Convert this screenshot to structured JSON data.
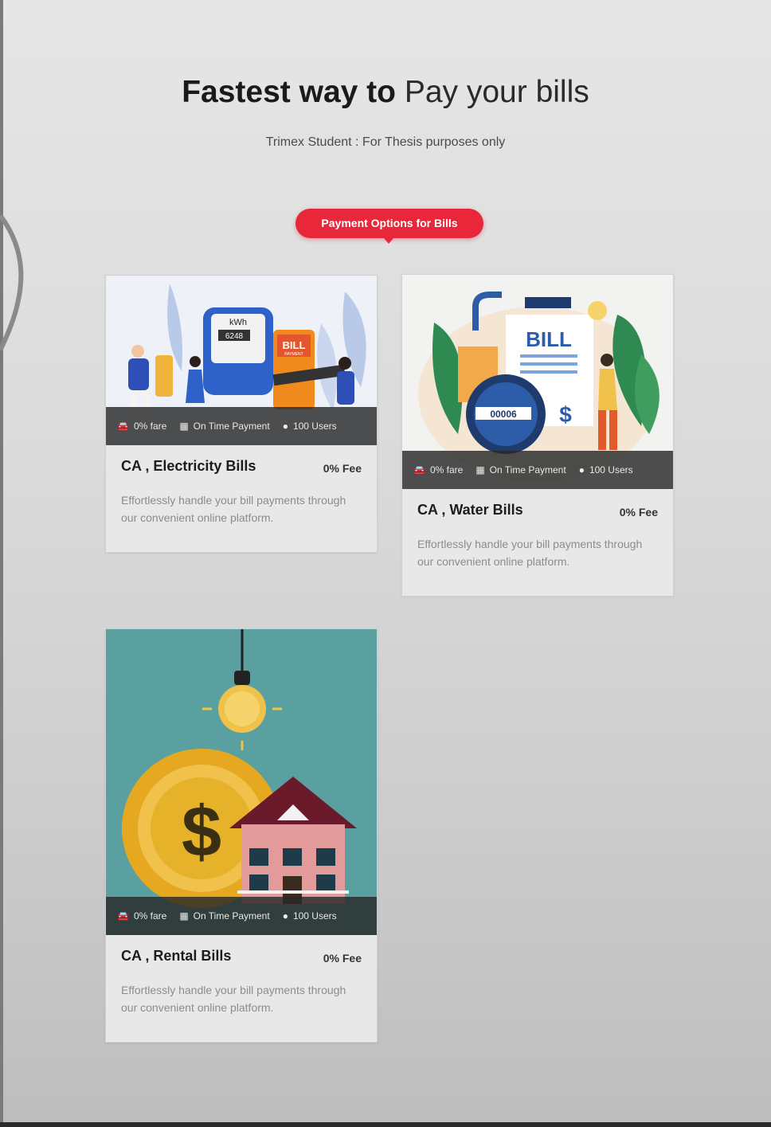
{
  "header": {
    "title_bold": "Fastest way to",
    "title_light": "Pay your bills",
    "subtitle": "Trimex Student : For Thesis purposes only",
    "section_badge": "Payment Options for Bills"
  },
  "cards": [
    {
      "title": "CA , Electricity Bills",
      "fee": "0% Fee",
      "description": "Effortlessly handle your bill payments through our convenient online platform.",
      "meta": {
        "fare": "0% fare",
        "payment": "On Time Payment",
        "users": "100 Users"
      },
      "image_labels": {
        "unit": "kWh",
        "reading": "6248",
        "badge": "BILL",
        "badge_sub": "PAYMENT"
      }
    },
    {
      "title": "CA , Water Bills",
      "fee": "0% Fee",
      "description": "Effortlessly handle your bill payments through our convenient online platform.",
      "meta": {
        "fare": "0% fare",
        "payment": "On Time Payment",
        "users": "100 Users"
      },
      "image_labels": {
        "badge": "BILL",
        "reading": "00006",
        "currency": "$"
      }
    },
    {
      "title": "CA , Rental Bills",
      "fee": "0% Fee",
      "description": "Effortlessly handle your bill payments through our convenient online platform.",
      "meta": {
        "fare": "0% fare",
        "payment": "On Time Payment",
        "users": "100 Users"
      },
      "image_labels": {
        "currency": "$"
      }
    }
  ],
  "icons": {
    "fare": "car-icon",
    "payment": "calendar-icon",
    "users": "user-icon"
  },
  "colors": {
    "accent": "#e8283a",
    "teal": "#5aa0a0",
    "meta_bar": "#2e2e2e"
  }
}
